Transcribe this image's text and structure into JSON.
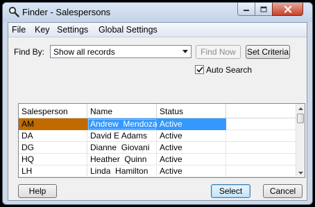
{
  "window": {
    "title": "Finder - Salespersons"
  },
  "menu": [
    "File",
    "Key",
    "Settings",
    "Global Settings"
  ],
  "find": {
    "label": "Find By:",
    "selected": "Show all records",
    "find_now_label": "Find Now",
    "set_criteria_label": "Set Criteria",
    "auto_search_label": "Auto Search",
    "auto_search_checked": true
  },
  "grid": {
    "columns": [
      "Salesperson",
      "Name",
      "Status"
    ],
    "rows": [
      {
        "code": "AM",
        "name": "Andrew  Mendoza",
        "status": "Active",
        "selected": true
      },
      {
        "code": "DA",
        "name": "David E Adams",
        "status": "Active",
        "selected": false
      },
      {
        "code": "DG",
        "name": "Dianne  Giovani",
        "status": "Active",
        "selected": false
      },
      {
        "code": "HQ",
        "name": "Heather  Quinn",
        "status": "Active",
        "selected": false
      },
      {
        "code": "LH",
        "name": "Linda  Hamilton",
        "status": "Active",
        "selected": false
      }
    ]
  },
  "footer": {
    "help_label": "Help",
    "select_label": "Select",
    "cancel_label": "Cancel"
  },
  "colors": {
    "selection_blue": "#3399ff",
    "selection_key": "#c06a00"
  }
}
